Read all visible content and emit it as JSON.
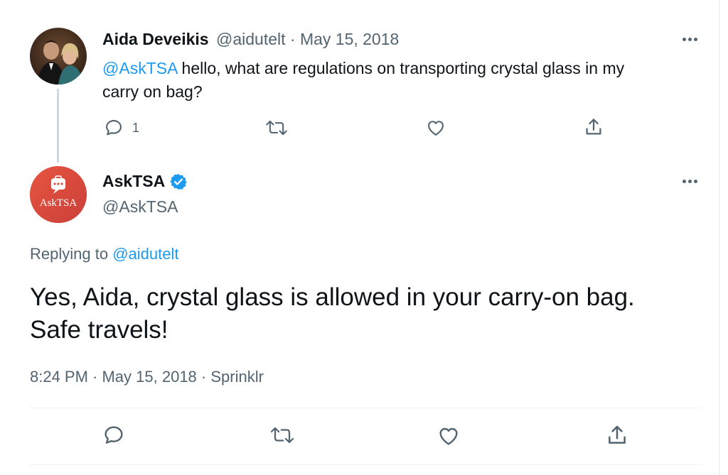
{
  "reply_to_tweet": {
    "author_name": "Aida Deveikis",
    "handle_and_date": "@aidutelt · May 15, 2018",
    "mention": "@AskTSA",
    "text_line1": " hello, what are regulations on transporting crystal glass in my",
    "text_line2": "carry on bag?",
    "reply_count": "1",
    "icons": [
      "reply-icon",
      "retweet-icon",
      "like-icon",
      "share-icon"
    ]
  },
  "main_tweet": {
    "author_name": "AskTSA",
    "verified": true,
    "handle": "@AskTSA",
    "avatar_text": "AskTSA",
    "replying_label": "Replying to ",
    "replying_handle": "@aidutelt",
    "text_line1": "Yes, Aida, crystal glass is allowed in your carry-on bag.",
    "text_line2": "Safe travels!",
    "meta": "8:24 PM · May 15, 2018 · Sprinklr",
    "icons": [
      "reply-icon",
      "retweet-icon",
      "like-icon",
      "share-icon"
    ]
  },
  "colors": {
    "link": "#1d9bf0",
    "muted": "#536471",
    "text": "#0f1419",
    "verified": "#1d9bf0",
    "tsa_avatar": "#e0503f"
  }
}
